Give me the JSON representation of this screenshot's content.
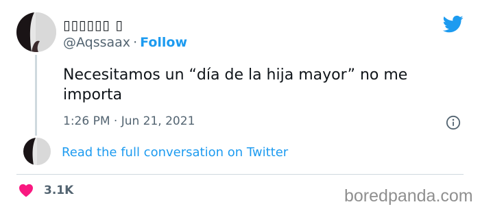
{
  "author": {
    "display_name": "▯▯▯▯▯▯ ▯",
    "handle": "@Aqssaax",
    "separator": "·",
    "follow_label": "Follow"
  },
  "tweet": {
    "text": "Necesitamos un “día de la hija mayor” no me importa",
    "timestamp": "1:26 PM · Jun 21, 2021"
  },
  "conversation": {
    "link_text": "Read the full conversation on Twitter"
  },
  "engagement": {
    "likes": "3.1K"
  },
  "watermark": {
    "text": "boredpanda.com"
  },
  "icons": {
    "bird": "twitter-bird-icon",
    "info": "info-icon",
    "heart": "heart-icon"
  },
  "colors": {
    "accent": "#1d9bf0",
    "heart": "#f91880",
    "muted": "#536471",
    "text": "#0f1419",
    "divider": "#cfd9de"
  }
}
